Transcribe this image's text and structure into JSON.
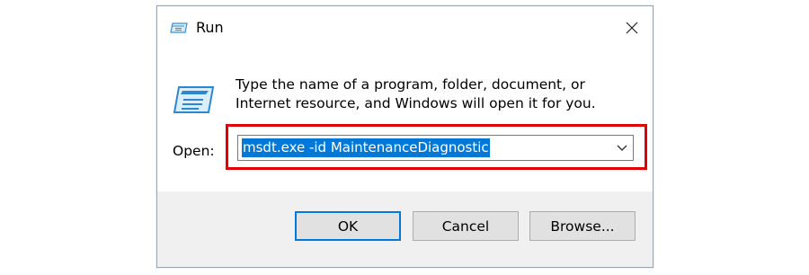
{
  "window": {
    "title": "Run",
    "title_icon": "run-icon",
    "close_icon": "close-icon"
  },
  "content": {
    "message": "Type the name of a program, folder, document, or Internet resource, and Windows will open it for you.",
    "icon": "run-icon",
    "open_label": "Open:",
    "open_value": "msdt.exe -id MaintenanceDiagnostic",
    "dropdown_icon": "chevron-down-icon",
    "highlight_color": "#e00000",
    "selection_color": "#0078d7"
  },
  "buttons": {
    "ok": "OK",
    "cancel": "Cancel",
    "browse": "Browse..."
  }
}
